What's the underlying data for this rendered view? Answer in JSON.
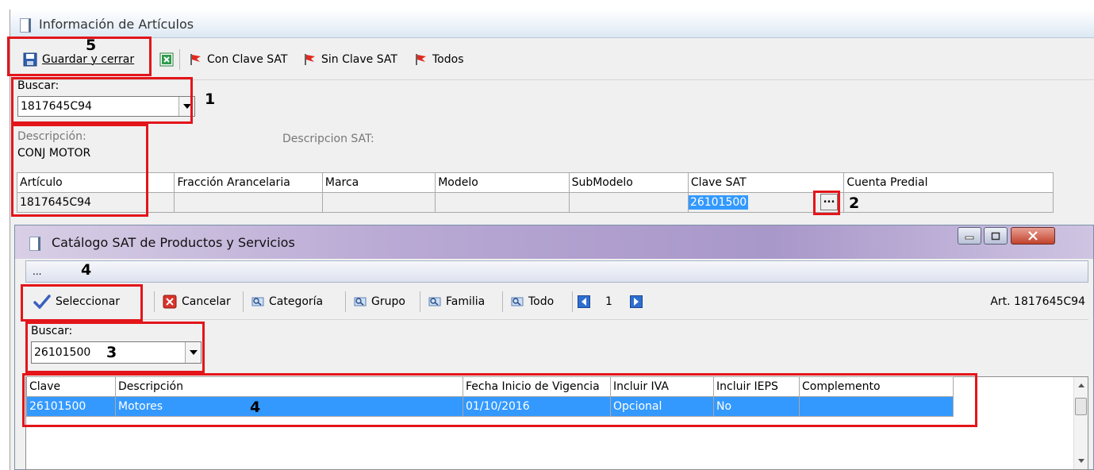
{
  "main": {
    "title": "Información de Artículos",
    "toolbar": {
      "save_close": "Guardar y cerrar",
      "with_sat": "Con Clave SAT",
      "without_sat": "Sin Clave SAT",
      "all": "Todos"
    },
    "search": {
      "label": "Buscar:",
      "value": "1817645C94"
    },
    "description": {
      "label": "Descripción:",
      "value": "CONJ MOTOR"
    },
    "sat_description_label": "Descripcion SAT:",
    "grid": {
      "headers": [
        "Artículo",
        "Fracción Arancelaria",
        "Marca",
        "Modelo",
        "SubModelo",
        "Clave SAT",
        "Cuenta Predial"
      ],
      "row": [
        "1817645C94",
        "",
        "",
        "",
        "",
        "26101500",
        ""
      ],
      "ellipsis": "..."
    }
  },
  "dialog": {
    "title": "Catálogo SAT de Productos y Servicios",
    "inner_bar": "...",
    "toolbar": {
      "select": "Seleccionar",
      "cancel": "Cancelar",
      "category": "Categoría",
      "group": "Grupo",
      "family": "Familia",
      "all": "Todo",
      "page": "1",
      "article": "Art. 1817645C94"
    },
    "search": {
      "label": "Buscar:",
      "value": "26101500"
    },
    "grid": {
      "headers": [
        "Clave",
        "Descripción",
        "Fecha Inicio de Vigencia",
        "Incluir IVA",
        "Incluir IEPS",
        "Complemento"
      ],
      "rows": [
        [
          "26101500",
          "Motores",
          "01/10/2016",
          "Opcional",
          "No",
          ""
        ]
      ]
    }
  },
  "callouts": {
    "n1": "1",
    "n2": "2",
    "n3": "3",
    "n4a": "4",
    "n4b": "4",
    "n5": "5"
  },
  "colors": {
    "highlight": "#e3151a",
    "selection": "#3399ff"
  }
}
